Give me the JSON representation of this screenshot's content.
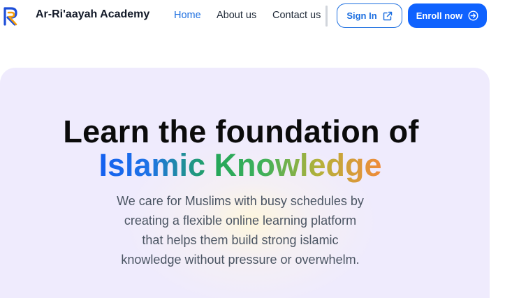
{
  "brand": {
    "name": "Ar-Ri'aayah Academy",
    "logo_icon": "ar-monogram-logo",
    "logo_colors": [
      "#1d4ed8",
      "#f59e0b"
    ]
  },
  "nav": {
    "items": [
      {
        "label": "Home",
        "active": true
      },
      {
        "label": "About us",
        "active": false
      },
      {
        "label": "Contact us",
        "active": false
      }
    ]
  },
  "actions": {
    "signin_label": "Sign In",
    "signin_icon": "external-link-icon",
    "enroll_label": "Enroll now",
    "enroll_icon": "arrow-circle-right-icon"
  },
  "hero": {
    "title_line1": "Learn the foundation of",
    "title_line2": "Islamic Knowledge",
    "subtitle_lines": [
      "We care for Muslims with busy schedules by",
      "creating a flexible online learning platform",
      "that helps them build strong islamic",
      "knowledge without pressure or overwhelm."
    ]
  },
  "colors": {
    "primary": "#0f62fe",
    "link_active": "#1d6fe0",
    "hero_bg": "#efebfd",
    "heading_gradient": [
      "#1460f0",
      "#22a65a",
      "#f08a3a"
    ]
  }
}
